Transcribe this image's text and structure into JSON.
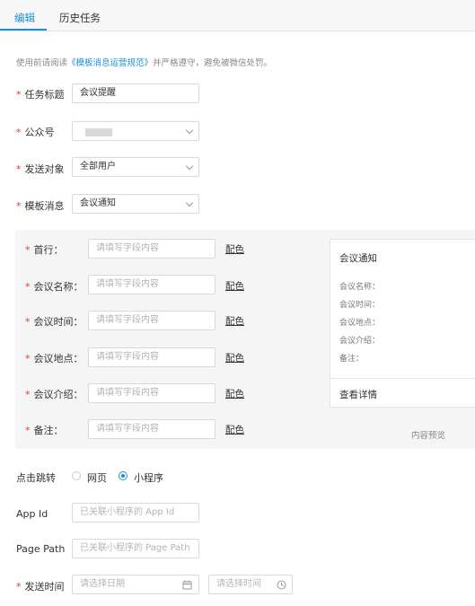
{
  "tabs": [
    {
      "label": "编辑"
    },
    {
      "label": "历史任务"
    }
  ],
  "notice": {
    "prefix": "使用前请阅读",
    "link": "《模板消息运营规范》",
    "suffix": "并严格遵守，避免被微信处罚。"
  },
  "form": {
    "title_label": "任务标题",
    "title_value": "会议提醒",
    "account_label": "公众号",
    "target_label": "发送对象",
    "target_value": "全部用户",
    "template_label": "模板消息",
    "template_value": "会议通知"
  },
  "fields": [
    {
      "label": "首行：",
      "placeholder": "请填写字段内容",
      "color": "配色"
    },
    {
      "label": "会议名称：",
      "placeholder": "请填写字段内容",
      "color": "配色"
    },
    {
      "label": "会议时间：",
      "placeholder": "请填写字段内容",
      "color": "配色"
    },
    {
      "label": "会议地点：",
      "placeholder": "请填写字段内容",
      "color": "配色"
    },
    {
      "label": "会议介绍：",
      "placeholder": "请填写字段内容",
      "color": "配色"
    },
    {
      "label": "备注：",
      "placeholder": "请填写字段内容",
      "color": "配色"
    }
  ],
  "preview": {
    "title": "会议通知",
    "fields": [
      "会议名称：",
      "会议时间：",
      "会议地点：",
      "会议介绍：",
      "备注："
    ],
    "detail": "查看详情",
    "caption": "内容预览"
  },
  "jump": {
    "label": "点击跳转",
    "option1": "网页",
    "option2": "小程序",
    "selected": "小程序"
  },
  "appid": {
    "label": "App Id",
    "placeholder": "已关联小程序的 App Id"
  },
  "pagepath": {
    "label": "Page Path",
    "placeholder": "已关联小程序的 Page Path"
  },
  "sendtime": {
    "label": "发送时间",
    "date_placeholder": "请选择日期",
    "time_placeholder": "请选择时间"
  },
  "colors": {
    "accent": "#1a8fd4",
    "required": "#e53935"
  }
}
